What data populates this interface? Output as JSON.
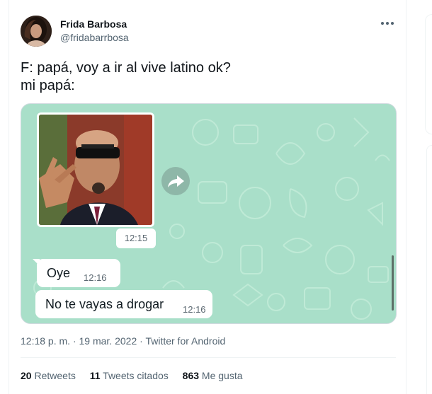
{
  "tweet": {
    "author": {
      "display_name": "Frida Barbosa",
      "handle": "@fridabarrbosa"
    },
    "text_line1": "F: papá, voy a ir al vive latino ok?",
    "text_line2": "mi papá:",
    "more_icon": "more-horizontal-icon",
    "meta": {
      "time": "12:18 p. m.",
      "sep1": "·",
      "date": "19 mar. 2022",
      "sep2": "·",
      "source": "Twitter for Android"
    },
    "stats": {
      "retweets_count": "20",
      "retweets_label": "Retweets",
      "quotes_count": "11",
      "quotes_label": "Tweets citados",
      "likes_count": "863",
      "likes_label": "Me gusta"
    }
  },
  "chat": {
    "image_time": "12:15",
    "forward_icon": "forward-arrow-icon",
    "messages": [
      {
        "text": "Oye",
        "time": "12:16"
      },
      {
        "text": "No te vayas a drogar",
        "time": "12:16"
      }
    ],
    "colors": {
      "wallpaper": "#a9dfc9",
      "bubble": "#ffffff"
    }
  }
}
